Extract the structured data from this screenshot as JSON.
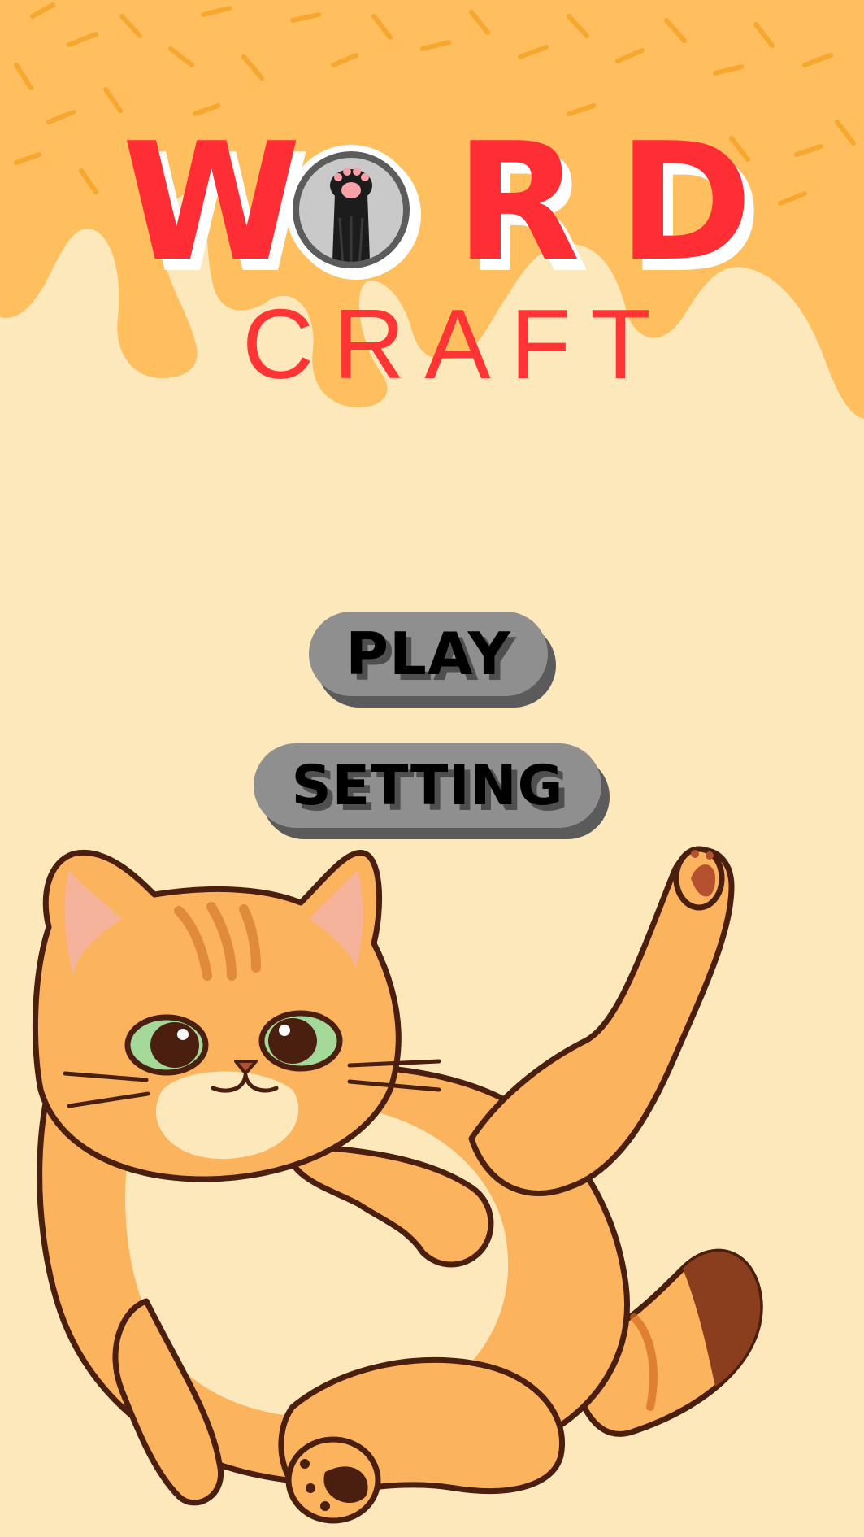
{
  "game": {
    "title_word": [
      "W",
      "",
      "R",
      "D"
    ],
    "title_subtitle": "CRAFT"
  },
  "menu": {
    "play_label": "PLAY",
    "setting_label": "SETTING"
  },
  "icons": {
    "logo_o": "cat-paw-icon",
    "mascot": "orange-cat-icon"
  },
  "colors": {
    "background": "#fde8bb",
    "drip": "#ffbf5f",
    "title_red": "#ff2e34",
    "button_face": "#8f8f8f",
    "button_shadow": "#5b5b5b",
    "cat_orange": "#fbb35e",
    "cat_outline": "#4a1f10"
  }
}
